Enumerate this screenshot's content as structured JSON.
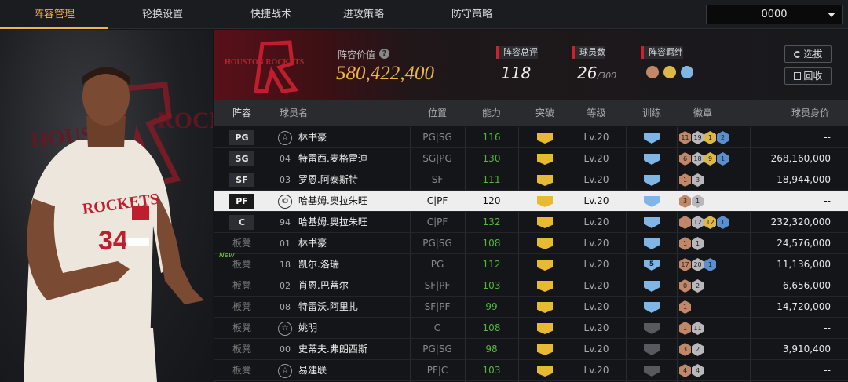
{
  "nav": {
    "tabs": [
      "阵容管理",
      "轮换设置",
      "快捷战术",
      "进攻策略",
      "防守策略"
    ],
    "active": 0
  },
  "coin_dropdown": {
    "value": "0000"
  },
  "team": {
    "logo_text": "HOUSTON ROCKETS",
    "left_player_jersey_team": "ROCKETS",
    "left_player_number": "34"
  },
  "header": {
    "lineup_value_label": "阵容价值",
    "lineup_value": "580,422,400",
    "total_rating_label": "阵容总评",
    "total_rating": "118",
    "player_count_label": "球员数",
    "player_count": "26",
    "player_count_max": "/300",
    "chemistry_label": "阵容羁绊"
  },
  "buttons": {
    "select": "选拔",
    "recycle": "回收"
  },
  "columns": [
    "阵容",
    "球员名",
    "位置",
    "能力",
    "突破",
    "等级",
    "训练",
    "徽章",
    "球员身价"
  ],
  "rows": [
    {
      "slot": "PG",
      "jersey": "",
      "star": true,
      "name": "林书豪",
      "pos": "PG|SG",
      "ability": "116",
      "level": "Lv.20",
      "train": "blue",
      "train_num": "",
      "badges": [
        [
          "b",
          "11"
        ],
        [
          "s",
          "19"
        ],
        [
          "g",
          "1"
        ],
        [
          "p",
          "2"
        ]
      ],
      "salary": "--"
    },
    {
      "slot": "SG",
      "jersey": "04",
      "star": false,
      "name": "特雷西.麦格雷迪",
      "pos": "SG|PG",
      "ability": "130",
      "level": "Lv.20",
      "train": "blue",
      "train_num": "",
      "badges": [
        [
          "b",
          "6"
        ],
        [
          "s",
          "18"
        ],
        [
          "g",
          "9"
        ],
        [
          "p",
          "1"
        ]
      ],
      "salary": "268,160,000"
    },
    {
      "slot": "SF",
      "jersey": "03",
      "star": false,
      "name": "罗恩.阿泰斯特",
      "pos": "SF",
      "ability": "111",
      "level": "Lv.20",
      "train": "blue",
      "train_num": "",
      "badges": [
        [
          "b",
          "1"
        ],
        [
          "s",
          "3"
        ]
      ],
      "salary": "18,944,000"
    },
    {
      "slot": "PF",
      "jersey": "",
      "star": false,
      "copy": true,
      "name": "哈基姆.奥拉朱旺",
      "pos": "C|PF",
      "ability": "120",
      "level": "Lv.20",
      "train": "blue",
      "train_num": "",
      "badges": [
        [
          "b",
          "3"
        ],
        [
          "s",
          "1"
        ]
      ],
      "salary": "--",
      "selected": true
    },
    {
      "slot": "C",
      "jersey": "94",
      "star": false,
      "name": "哈基姆.奥拉朱旺",
      "pos": "C|PF",
      "ability": "132",
      "level": "Lv.20",
      "train": "blue",
      "train_num": "",
      "badges": [
        [
          "b",
          "1"
        ],
        [
          "s",
          "12"
        ],
        [
          "g",
          "12"
        ],
        [
          "p",
          "1"
        ]
      ],
      "salary": "232,320,000"
    },
    {
      "slot": "板凳",
      "jersey": "01",
      "star": false,
      "name": "林书豪",
      "pos": "PG|SG",
      "ability": "108",
      "level": "Lv.20",
      "train": "blue",
      "train_num": "",
      "badges": [
        [
          "b",
          "1"
        ],
        [
          "s",
          "1"
        ]
      ],
      "salary": "24,576,000"
    },
    {
      "slot": "板凳",
      "new": "New",
      "jersey": "18",
      "star": false,
      "name": "凯尔.洛瑞",
      "pos": "PG",
      "ability": "112",
      "level": "Lv.20",
      "train": "blue",
      "train_num": "5",
      "badges": [
        [
          "b",
          "17"
        ],
        [
          "s",
          "20"
        ],
        [
          "p",
          "1"
        ]
      ],
      "salary": "11,136,000"
    },
    {
      "slot": "板凳",
      "jersey": "02",
      "star": false,
      "name": "肖恩.巴蒂尔",
      "pos": "SF|PF",
      "ability": "103",
      "level": "Lv.20",
      "train": "blue",
      "train_num": "",
      "badges": [
        [
          "b",
          "0"
        ],
        [
          "s",
          "2"
        ]
      ],
      "salary": "6,656,000"
    },
    {
      "slot": "板凳",
      "jersey": "08",
      "star": false,
      "name": "特雷沃.阿里扎",
      "pos": "SF|PF",
      "ability": "99",
      "level": "Lv.20",
      "train": "blue",
      "train_num": "",
      "badges": [
        [
          "b",
          "1"
        ]
      ],
      "salary": "14,720,000"
    },
    {
      "slot": "板凳",
      "jersey": "",
      "star": true,
      "name": "姚明",
      "pos": "C",
      "ability": "108",
      "level": "Lv.20",
      "train": "grey",
      "train_num": "",
      "badges": [
        [
          "b",
          "1"
        ],
        [
          "s",
          "11"
        ]
      ],
      "salary": "--"
    },
    {
      "slot": "板凳",
      "jersey": "00",
      "star": false,
      "name": "史蒂夫.弗朗西斯",
      "pos": "PG|SG",
      "ability": "98",
      "level": "Lv.20",
      "train": "grey",
      "train_num": "",
      "badges": [
        [
          "b",
          "3"
        ],
        [
          "s",
          "2"
        ]
      ],
      "salary": "3,910,400"
    },
    {
      "slot": "板凳",
      "jersey": "",
      "star": true,
      "name": "易建联",
      "pos": "PF|C",
      "ability": "103",
      "level": "Lv.20",
      "train": "grey",
      "train_num": "",
      "badges": [
        [
          "b",
          "4"
        ],
        [
          "s",
          "4"
        ]
      ],
      "salary": "--"
    }
  ]
}
